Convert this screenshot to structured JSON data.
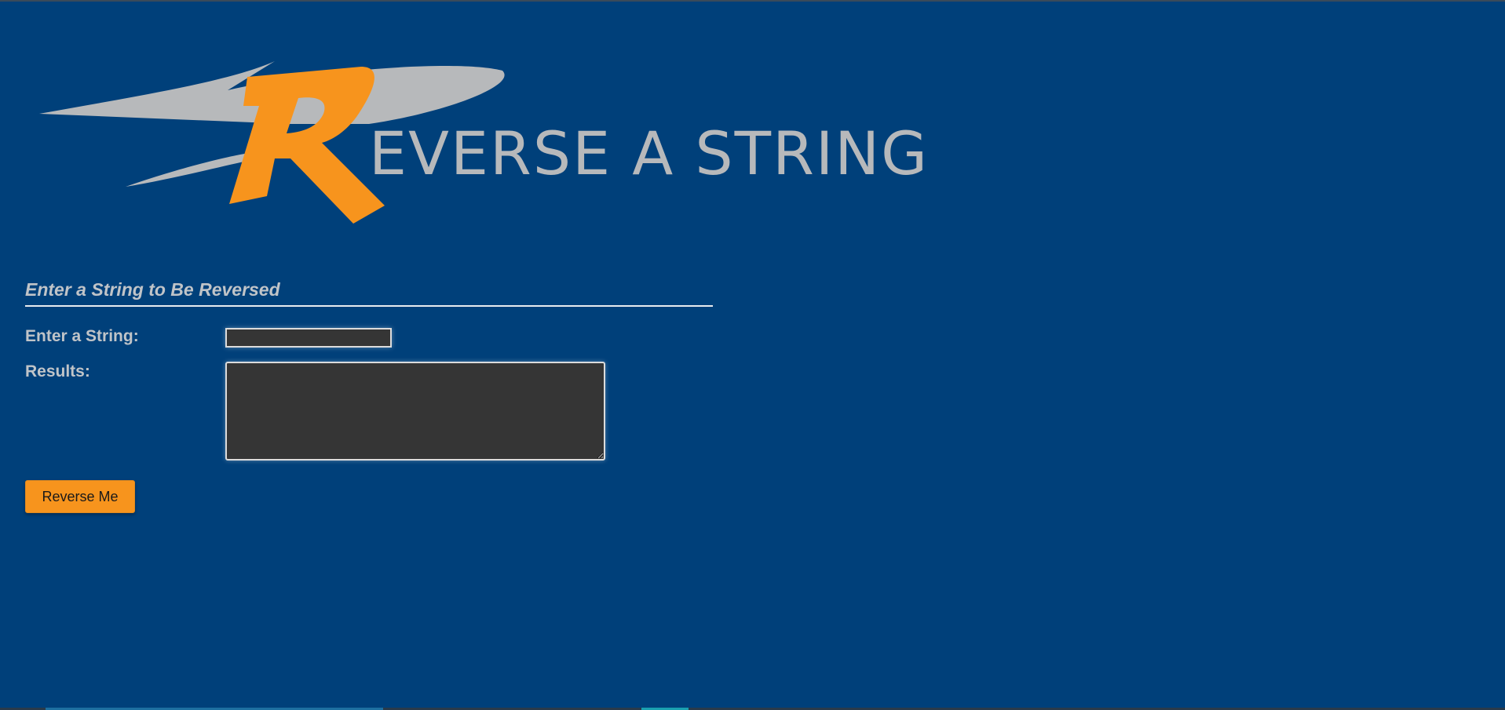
{
  "app": {
    "title": "REVERSE A STRING",
    "logo_letter": "R",
    "logo_rest": "EVERSE A STRING"
  },
  "form": {
    "section_title": "Enter a String to Be Reversed",
    "string_label": "Enter a String:",
    "string_value": "",
    "results_label": "Results:",
    "results_value": "",
    "button_label": "Reverse Me"
  },
  "colors": {
    "background": "#00407a",
    "accent": "#f7941d",
    "logo_gray": "#b7b9bb",
    "input_bg": "#353535"
  }
}
